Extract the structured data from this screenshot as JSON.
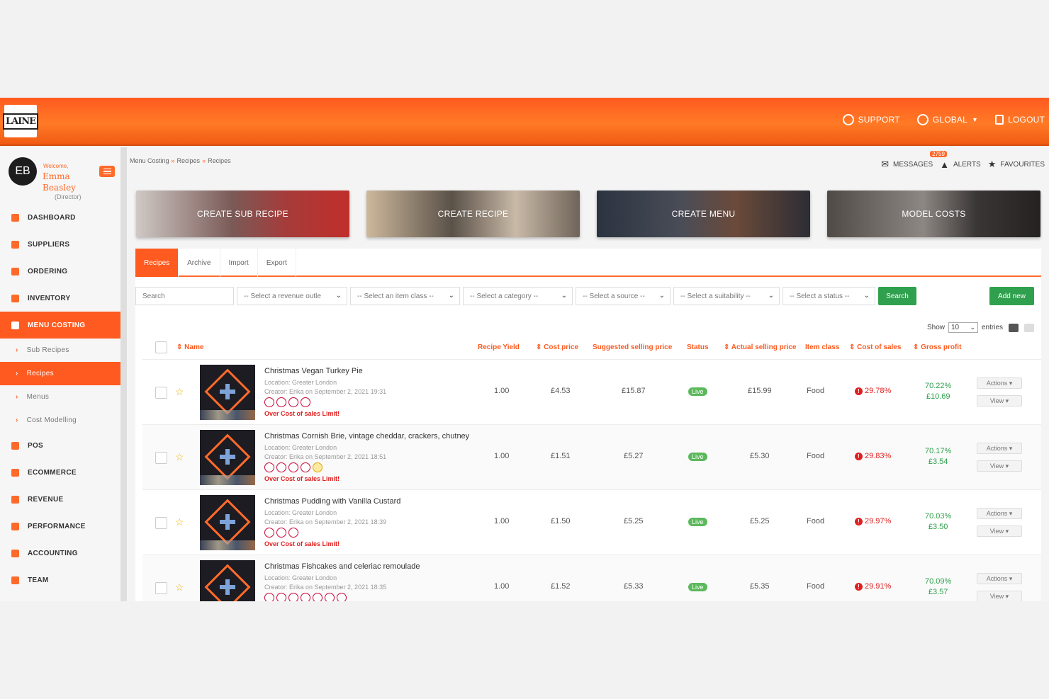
{
  "logo": "LAINE",
  "topnav": {
    "support": "SUPPORT",
    "global": "GLOBAL",
    "logout": "LOGOUT"
  },
  "profile": {
    "initials": "EB",
    "welcome": "Welcome,",
    "name": "Emma Beasley",
    "role": "(Director)"
  },
  "sidebar": {
    "items": [
      {
        "label": "DASHBOARD",
        "icon": "dashboard-icon"
      },
      {
        "label": "SUPPLIERS",
        "icon": "truck-icon"
      },
      {
        "label": "ORDERING",
        "icon": "basket-icon"
      },
      {
        "label": "INVENTORY",
        "icon": "boxes-icon"
      },
      {
        "label": "MENU COSTING",
        "icon": "calculator-icon"
      },
      {
        "label": "Sub Recipes"
      },
      {
        "label": "Recipes"
      },
      {
        "label": "Menus"
      },
      {
        "label": "Cost Modelling"
      },
      {
        "label": "POS",
        "icon": "pos-icon"
      },
      {
        "label": "ECOMMERCE",
        "icon": "cart-icon"
      },
      {
        "label": "REVENUE",
        "icon": "revenue-icon"
      },
      {
        "label": "PERFORMANCE",
        "icon": "performance-icon"
      },
      {
        "label": "ACCOUNTING",
        "icon": "ledger-icon"
      },
      {
        "label": "TEAM",
        "icon": "team-icon"
      }
    ]
  },
  "breadcrumb": [
    "Menu Costing",
    "Recipes",
    "Recipes"
  ],
  "rightlinks": {
    "messages": "MESSAGES",
    "alerts_badge": "2759",
    "alerts": "ALERTS",
    "favourites": "FAVOURITES"
  },
  "tiles": [
    "CREATE SUB RECIPE",
    "CREATE RECIPE",
    "CREATE MENU",
    "MODEL COSTS"
  ],
  "tabs": [
    "Recipes",
    "Archive",
    "Import",
    "Export"
  ],
  "filters": {
    "search_placeholder": "Search",
    "revenue_outlet": "-- Select a revenue outle",
    "item_class": "-- Select an item class --",
    "category": "-- Select a category --",
    "source": "-- Select a source --",
    "suitability": "-- Select a suitability --",
    "status": "-- Select a status --",
    "search_btn": "Search",
    "add_btn": "Add new"
  },
  "show": {
    "label": "Show",
    "value": "10",
    "suffix": "entries"
  },
  "columns": {
    "name": "Name",
    "yield": "Recipe Yield",
    "cost": "Cost price",
    "suggested": "Suggested selling price",
    "status": "Status",
    "actual": "Actual selling price",
    "item_class": "Item class",
    "cos": "Cost of sales",
    "gp": "Gross profit"
  },
  "rows": [
    {
      "name": "Christmas Vegan Turkey Pie",
      "location": "Location: Greater London",
      "creator": "Creator: Erika on September 2, 2021 19:31",
      "warning": "Over Cost of sales Limit!",
      "yield": "1.00",
      "cost": "£4.53",
      "suggested": "£15.87",
      "status": "Live",
      "actual": "£15.99",
      "item_class": "Food",
      "cos": "29.78%",
      "gp_pct": "70.22%",
      "gp_val": "£10.69",
      "actions": "Actions",
      "view": "View"
    },
    {
      "name": "Christmas Cornish Brie, vintage cheddar, crackers, chutney",
      "location": "Location: Greater London",
      "creator": "Creator: Erika on September 2, 2021 18:51",
      "warning": "Over Cost of sales Limit!",
      "yield": "1.00",
      "cost": "£1.51",
      "suggested": "£5.27",
      "status": "Live",
      "actual": "£5.30",
      "item_class": "Food",
      "cos": "29.83%",
      "gp_pct": "70.17%",
      "gp_val": "£3.54",
      "actions": "Actions",
      "view": "View"
    },
    {
      "name": "Christmas Pudding with Vanilla Custard",
      "location": "Location: Greater London",
      "creator": "Creator: Erika on September 2, 2021 18:39",
      "warning": "Over Cost of sales Limit!",
      "yield": "1.00",
      "cost": "£1.50",
      "suggested": "£5.25",
      "status": "Live",
      "actual": "£5.25",
      "item_class": "Food",
      "cos": "29.97%",
      "gp_pct": "70.03%",
      "gp_val": "£3.50",
      "actions": "Actions",
      "view": "View"
    },
    {
      "name": "Christmas Fishcakes and celeriac remoulade",
      "location": "Location: Greater London",
      "creator": "Creator: Erika on September 2, 2021 18:35",
      "warning": "",
      "yield": "1.00",
      "cost": "£1.52",
      "suggested": "£5.33",
      "status": "Live",
      "actual": "£5.35",
      "item_class": "Food",
      "cos": "29.91%",
      "gp_pct": "70.09%",
      "gp_val": "£3.57",
      "actions": "Actions",
      "view": "View"
    }
  ]
}
